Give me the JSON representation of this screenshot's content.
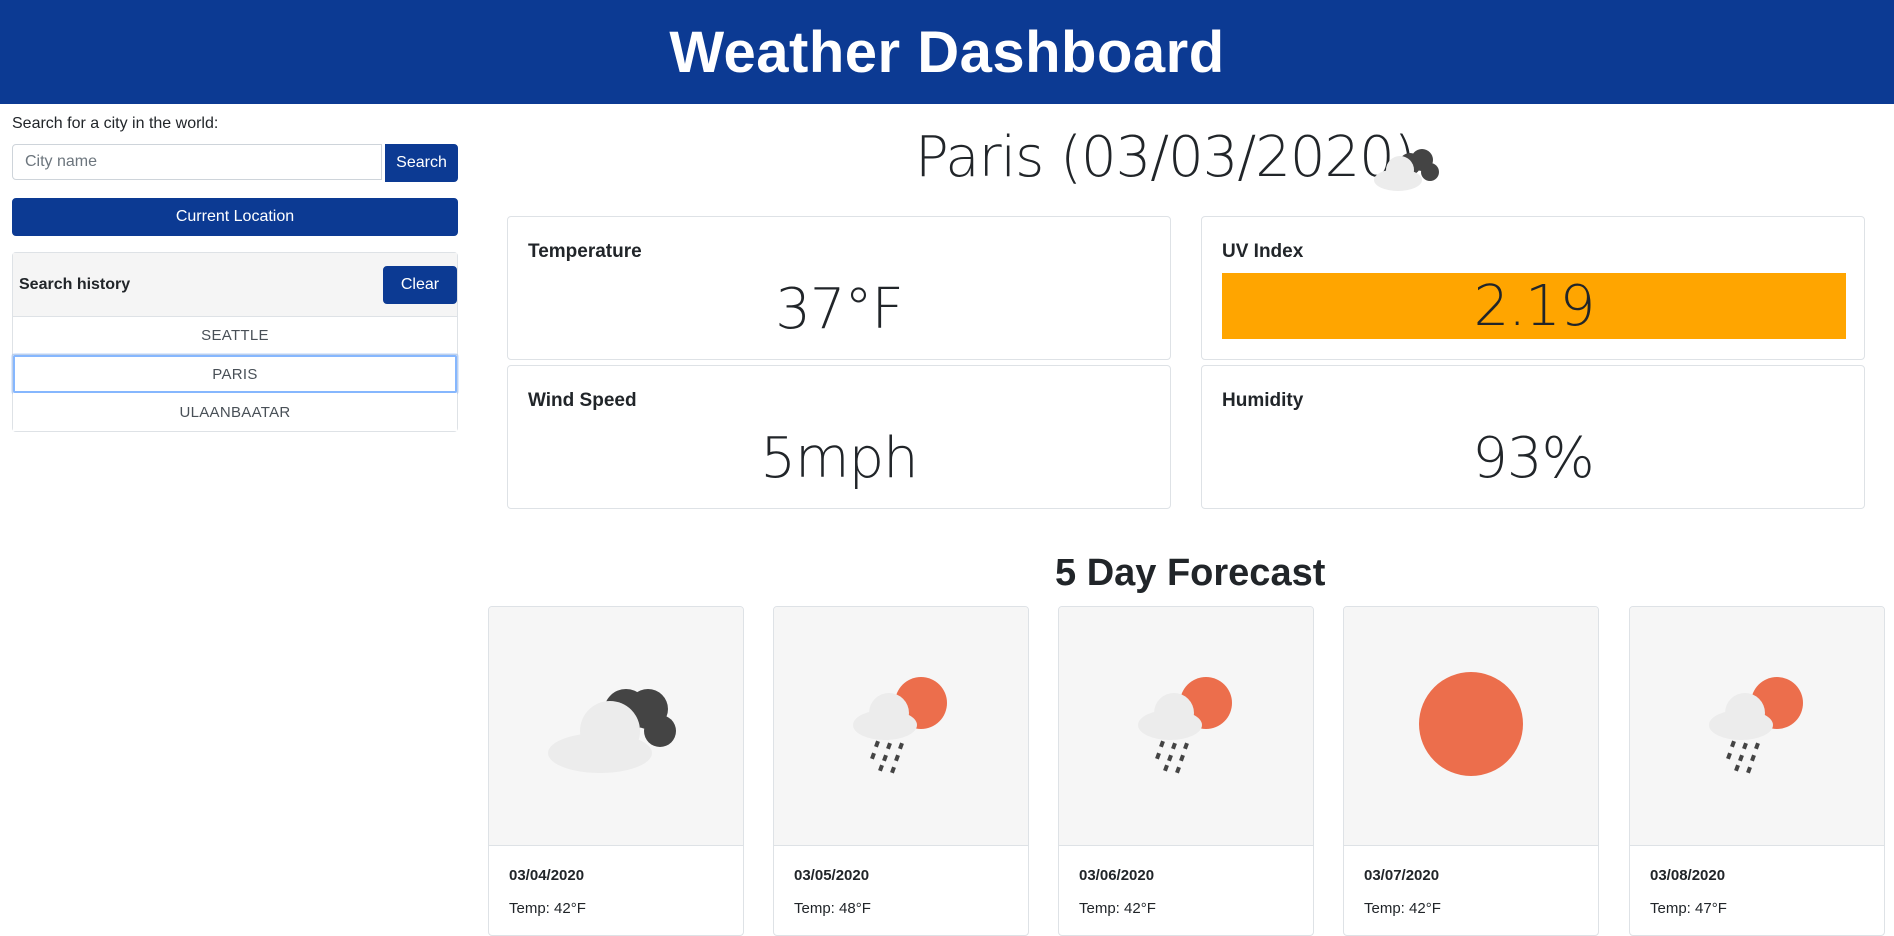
{
  "header": {
    "title": "Weather Dashboard"
  },
  "sidebar": {
    "search_label": "Search for a city in the world:",
    "search_placeholder": "City name",
    "search_button": "Search",
    "current_location_button": "Current Location",
    "history_title": "Search history",
    "clear_button": "Clear",
    "history_items": [
      "SEATTLE",
      "PARIS",
      "ULAANBAATAR"
    ],
    "active_item": "PARIS"
  },
  "current": {
    "title": "Paris (03/03/2020)",
    "icon": "cloudy-icon",
    "temperature_label": "Temperature",
    "temperature_value": "37°F",
    "uv_label": "UV Index",
    "uv_value": "2.19",
    "uv_color": "#ffa500",
    "wind_label": "Wind Speed",
    "wind_value": "5mph",
    "humidity_label": "Humidity",
    "humidity_value": "93%"
  },
  "forecast": {
    "title": "5 Day Forecast",
    "days": [
      {
        "date": "03/04/2020",
        "temp": "Temp: 42°F",
        "icon": "cloudy-icon"
      },
      {
        "date": "03/05/2020",
        "temp": "Temp: 48°F",
        "icon": "sun-rain-icon"
      },
      {
        "date": "03/06/2020",
        "temp": "Temp: 42°F",
        "icon": "sun-rain-icon"
      },
      {
        "date": "03/07/2020",
        "temp": "Temp: 42°F",
        "icon": "sun-icon"
      },
      {
        "date": "03/08/2020",
        "temp": "Temp: 47°F",
        "icon": "sun-rain-icon"
      }
    ]
  },
  "colors": {
    "brand": "#0c3a93",
    "uv": "#ffa500",
    "sun": "#ec6e4c"
  }
}
